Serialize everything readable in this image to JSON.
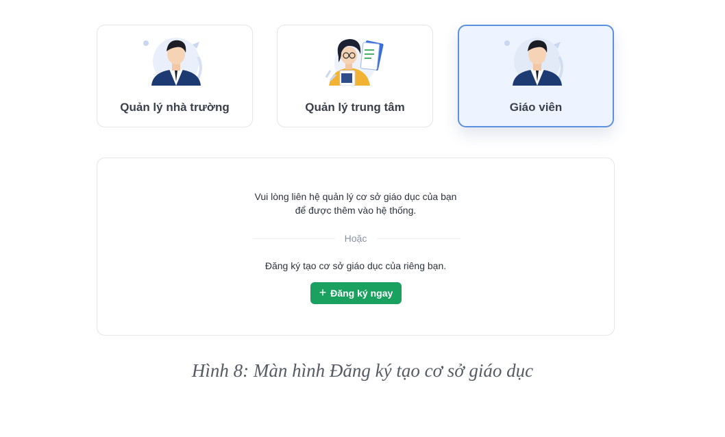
{
  "roles": [
    {
      "label": "Quản lý nhà trường",
      "icon": "school-manager-illustration",
      "selected": false
    },
    {
      "label": "Quản lý trung tâm",
      "icon": "center-manager-illustration",
      "selected": false
    },
    {
      "label": "Giáo viên",
      "icon": "teacher-illustration",
      "selected": true
    }
  ],
  "panel": {
    "contact_line1": "Vui lòng liên hệ quản lý cơ sở giáo dục của bạn",
    "contact_line2": "để được thêm vào hệ thống.",
    "divider_label": "Hoặc",
    "register_prompt": "Đăng ký tạo cơ sở giáo dục của riêng bạn.",
    "register_button": "Đăng ký ngay",
    "register_icon": "plus-icon"
  },
  "caption": "Hình 8: Màn hình Đăng ký tạo cơ sở giáo dục",
  "colors": {
    "accent": "#1aa160",
    "selected_border": "#5b8fe0",
    "selected_bg": "#eef4ff",
    "suit": "#1e3a72"
  }
}
